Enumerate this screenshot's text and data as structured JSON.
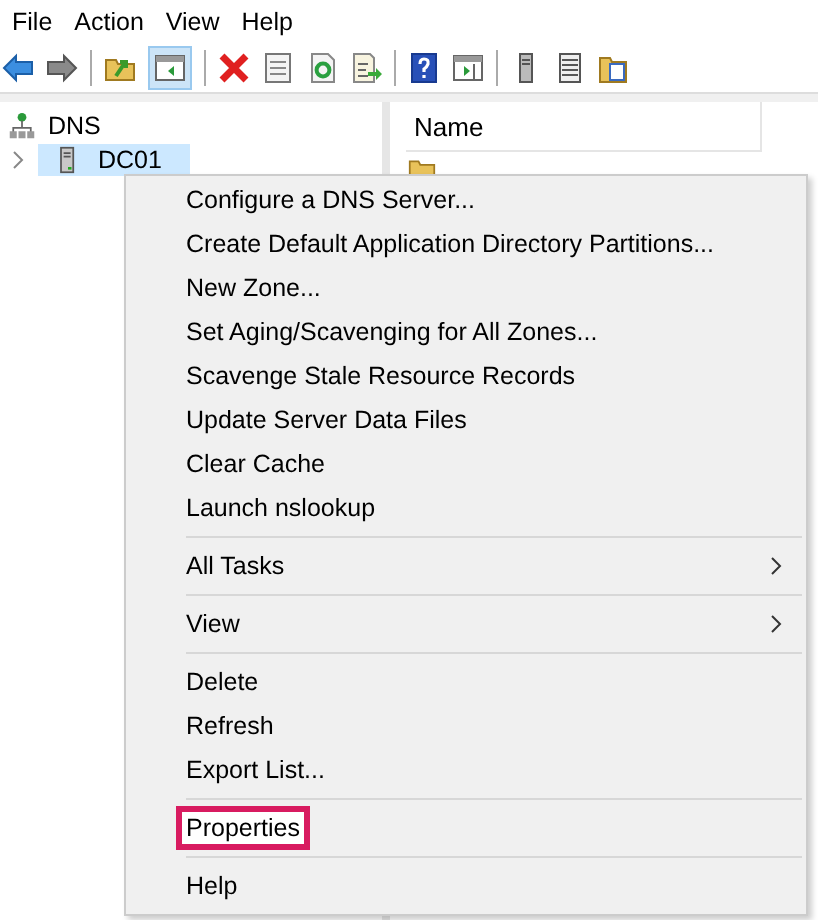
{
  "menubar": [
    {
      "label": "File"
    },
    {
      "label": "Action"
    },
    {
      "label": "View"
    },
    {
      "label": "Help"
    }
  ],
  "tree": [
    {
      "label": "DNS",
      "expanded": true,
      "selected": false,
      "children": [
        {
          "label": "DC01",
          "expanded": false,
          "selected": true
        }
      ]
    }
  ],
  "list": {
    "columns": [
      {
        "label": "Name"
      }
    ]
  },
  "context_menu": [
    {
      "kind": "item",
      "label": "Configure a DNS Server...",
      "submenu": false,
      "highlighted": false
    },
    {
      "kind": "item",
      "label": "Create Default Application Directory Partitions...",
      "submenu": false,
      "highlighted": false
    },
    {
      "kind": "item",
      "label": "New Zone...",
      "submenu": false,
      "highlighted": false
    },
    {
      "kind": "item",
      "label": "Set Aging/Scavenging for All Zones...",
      "submenu": false,
      "highlighted": false
    },
    {
      "kind": "item",
      "label": "Scavenge Stale Resource Records",
      "submenu": false,
      "highlighted": false
    },
    {
      "kind": "item",
      "label": "Update Server Data Files",
      "submenu": false,
      "highlighted": false
    },
    {
      "kind": "item",
      "label": "Clear Cache",
      "submenu": false,
      "highlighted": false
    },
    {
      "kind": "item",
      "label": "Launch nslookup",
      "submenu": false,
      "highlighted": false
    },
    {
      "kind": "separator"
    },
    {
      "kind": "item",
      "label": "All Tasks",
      "submenu": true,
      "highlighted": false
    },
    {
      "kind": "separator"
    },
    {
      "kind": "item",
      "label": "View",
      "submenu": true,
      "highlighted": false
    },
    {
      "kind": "separator"
    },
    {
      "kind": "item",
      "label": "Delete",
      "submenu": false,
      "highlighted": false
    },
    {
      "kind": "item",
      "label": "Refresh",
      "submenu": false,
      "highlighted": false
    },
    {
      "kind": "item",
      "label": "Export List...",
      "submenu": false,
      "highlighted": false
    },
    {
      "kind": "separator"
    },
    {
      "kind": "item",
      "label": "Properties",
      "submenu": false,
      "highlighted": true
    },
    {
      "kind": "separator"
    },
    {
      "kind": "item",
      "label": "Help",
      "submenu": false,
      "highlighted": false
    }
  ]
}
